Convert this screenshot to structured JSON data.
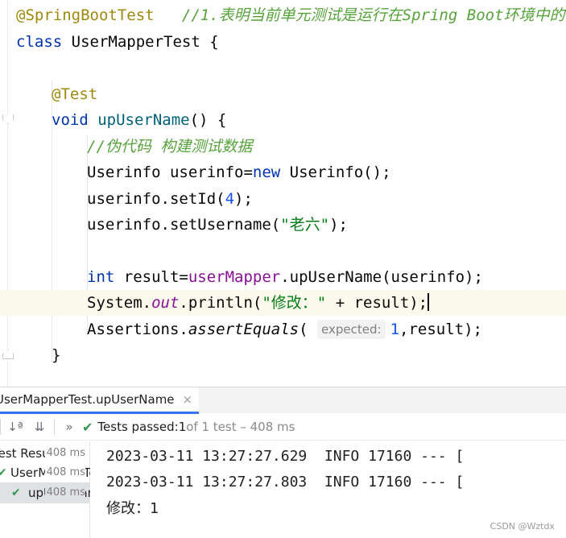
{
  "editor": {
    "l1_annotation": "@SpringBootTest",
    "l1_comment": "//1.表明当前单元测试是运行在Spring Boot环境中的",
    "l2_kw": "class",
    "l2_name": "UserMapperTest",
    "l2_brace": " {",
    "l4_annotation": "@Test",
    "l5_kw": "void",
    "l5_method": "upUserName",
    "l5_rest": "() {",
    "l6_comment": "//伪代码 构建测试数据",
    "l7_a": "Userinfo userinfo=",
    "l7_kw": "new",
    "l7_b": " Userinfo();",
    "l8_a": "userinfo.setId(",
    "l8_num": "4",
    "l8_b": ");",
    "l9_a": "userinfo.setUsername(",
    "l9_str": "\"老六\"",
    "l9_b": ");",
    "l11_kw": "int",
    "l11_a": " result=",
    "l11_field": "userMapper",
    "l11_b": ".upUserName(userinfo);",
    "l12_a": "System.",
    "l12_out": "out",
    "l12_b": ".println(",
    "l12_str": "\"修改：\"",
    "l12_c": " + result);",
    "l13_a": "Assertions.",
    "l13_method": "assertEquals",
    "l13_paren": "(",
    "l13_hint": "expected:",
    "l13_num": "1",
    "l13_b": ",result);",
    "l14_brace": "}"
  },
  "run_window": {
    "tab_label": "UserMapperTest.upUserName",
    "tab_close_icon": "×",
    "toolbar": {
      "sort_alpha_icon": "↓ª",
      "sort_duration_icon": "⇊",
      "more_icon": "»",
      "tests_passed_label": "Tests passed: ",
      "tests_passed_count": "1",
      "tests_total": " of 1 test – 408 ms"
    },
    "tree": [
      {
        "name": "Test Results",
        "time": "408 ms"
      },
      {
        "name": "UserMapperTest",
        "time": "408 ms"
      },
      {
        "name": "upUserName",
        "time": "408 ms"
      }
    ],
    "console_lines": [
      "2023-03-11 13:27:27.629  INFO 17160 --- [",
      "2023-03-11 13:27:27.803  INFO 17160 --- [",
      "修改：1"
    ]
  },
  "watermark": "CSDN @Wztdx",
  "colors": {
    "annotation": "#9e880d",
    "keyword": "#0033b3",
    "method": "#00627a",
    "comment": "#8c8c8c",
    "string": "#067d17",
    "number": "#1750eb",
    "field": "#871094",
    "pass_green": "#369650",
    "caret_line_bg": "#fcfaed"
  }
}
